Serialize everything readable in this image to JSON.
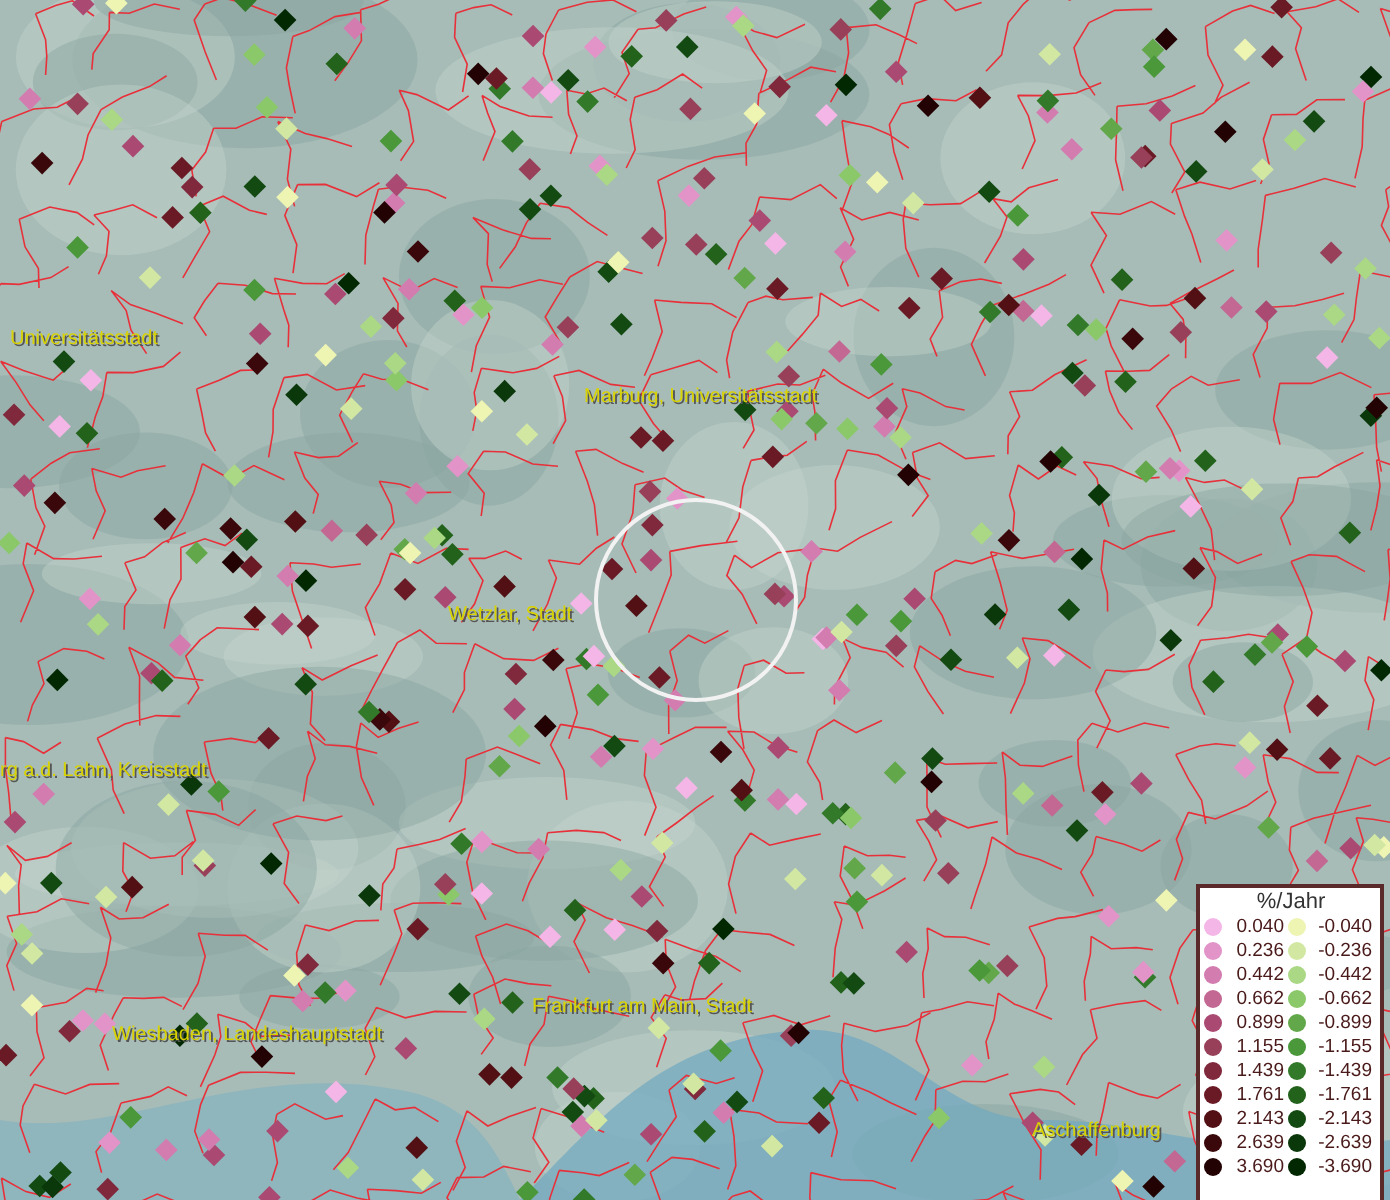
{
  "places": [
    {
      "label": "Universitätsstadt"
    },
    {
      "label": "Marburg, Universitätsstadt"
    },
    {
      "label": "Wetzlar, Stadt"
    },
    {
      "label": "rg a.d. Lahn, Kreisstadt"
    },
    {
      "label": "Wiesbaden, Landeshauptstadt"
    },
    {
      "label": "Frankfurt am Main, Stadt"
    },
    {
      "label": "Aschaffenburg"
    }
  ],
  "legend": {
    "title": "%/Jahr",
    "positive": [
      {
        "label": "0.040",
        "color": "#f4b6e6"
      },
      {
        "label": "0.236",
        "color": "#e294c8"
      },
      {
        "label": "0.442",
        "color": "#d27cb0"
      },
      {
        "label": "0.662",
        "color": "#c26892"
      },
      {
        "label": "0.899",
        "color": "#aa4a72"
      },
      {
        "label": "1.155",
        "color": "#98405a"
      },
      {
        "label": "1.439",
        "color": "#80283c"
      },
      {
        "label": "1.761",
        "color": "#6a1a24"
      },
      {
        "label": "2.143",
        "color": "#521014"
      },
      {
        "label": "2.639",
        "color": "#3a080a"
      },
      {
        "label": "3.690",
        "color": "#220202"
      }
    ],
    "negative": [
      {
        "label": "-0.040",
        "color": "#eef4b2"
      },
      {
        "label": "-0.236",
        "color": "#d2e8a2"
      },
      {
        "label": "-0.442",
        "color": "#aad884"
      },
      {
        "label": "-0.662",
        "color": "#8ac86a"
      },
      {
        "label": "-0.899",
        "color": "#62a84a"
      },
      {
        "label": "-1.155",
        "color": "#4a983a"
      },
      {
        "label": "-1.439",
        "color": "#327a2a"
      },
      {
        "label": "-1.761",
        "color": "#22621a"
      },
      {
        "label": "-2.143",
        "color": "#124a12"
      },
      {
        "label": "-2.639",
        "color": "#0a380a"
      },
      {
        "label": "-3.690",
        "color": "#022802"
      }
    ]
  }
}
